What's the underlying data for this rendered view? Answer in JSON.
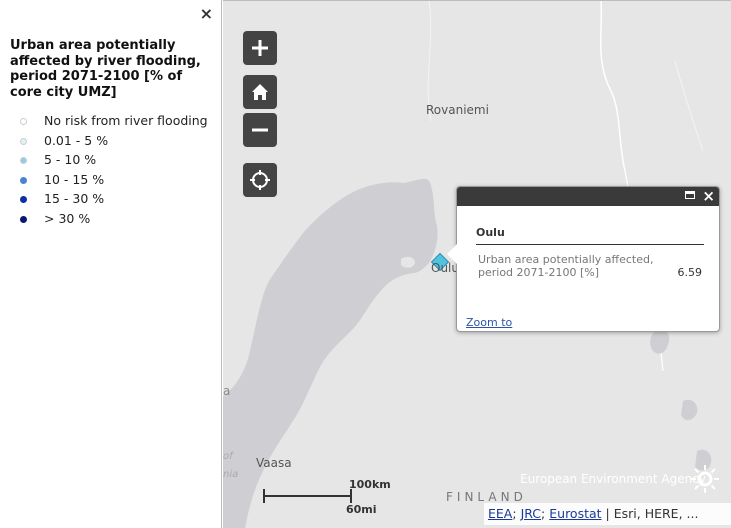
{
  "legend": {
    "close_label": "×",
    "title": "Urban area potentially affected by river flooding, period 2071-2100 [% of core city UMZ]",
    "items": [
      {
        "label": "No risk from river flooding",
        "color": "#ffffff"
      },
      {
        "label": "0.01 - 5 %",
        "color": "#def3f7"
      },
      {
        "label": "5 - 10 %",
        "color": "#8fcdee"
      },
      {
        "label": "10 - 15 %",
        "color": "#4a82d6"
      },
      {
        "label": "15 - 30 %",
        "color": "#0d2fa8"
      },
      {
        "label": "> 30 %",
        "color": "#0a1670"
      }
    ]
  },
  "map": {
    "labels": {
      "rovaniemi": "Rovaniemi",
      "oulu": "Oulu",
      "vaasa": "Vaasa",
      "finland": "FINLAND",
      "edge_a": "a",
      "edge_of": "of",
      "edge_nia": "nia"
    },
    "controls": {
      "zoom_in": "zoom-in",
      "home": "home",
      "zoom_out": "zoom-out",
      "locate": "locate"
    },
    "scale": {
      "km": "100km",
      "mi": "60mi"
    },
    "eea_logo_text": "European Environment Agency",
    "attribution": {
      "links": [
        "EEA",
        "JRC",
        "Eurostat"
      ],
      "separator": ";",
      "rest": "| Esri, HERE, ..."
    }
  },
  "popup": {
    "title": "Oulu",
    "field_label": "Urban area potentially affected, period 2071-2100 [%]",
    "field_value": "6.59",
    "zoom_link": "Zoom to",
    "close_label": "×"
  },
  "colors": {
    "water": "#cfcfd3",
    "land": "#e6e6e6",
    "control": "#444444",
    "marker": "#4fc3e0"
  }
}
